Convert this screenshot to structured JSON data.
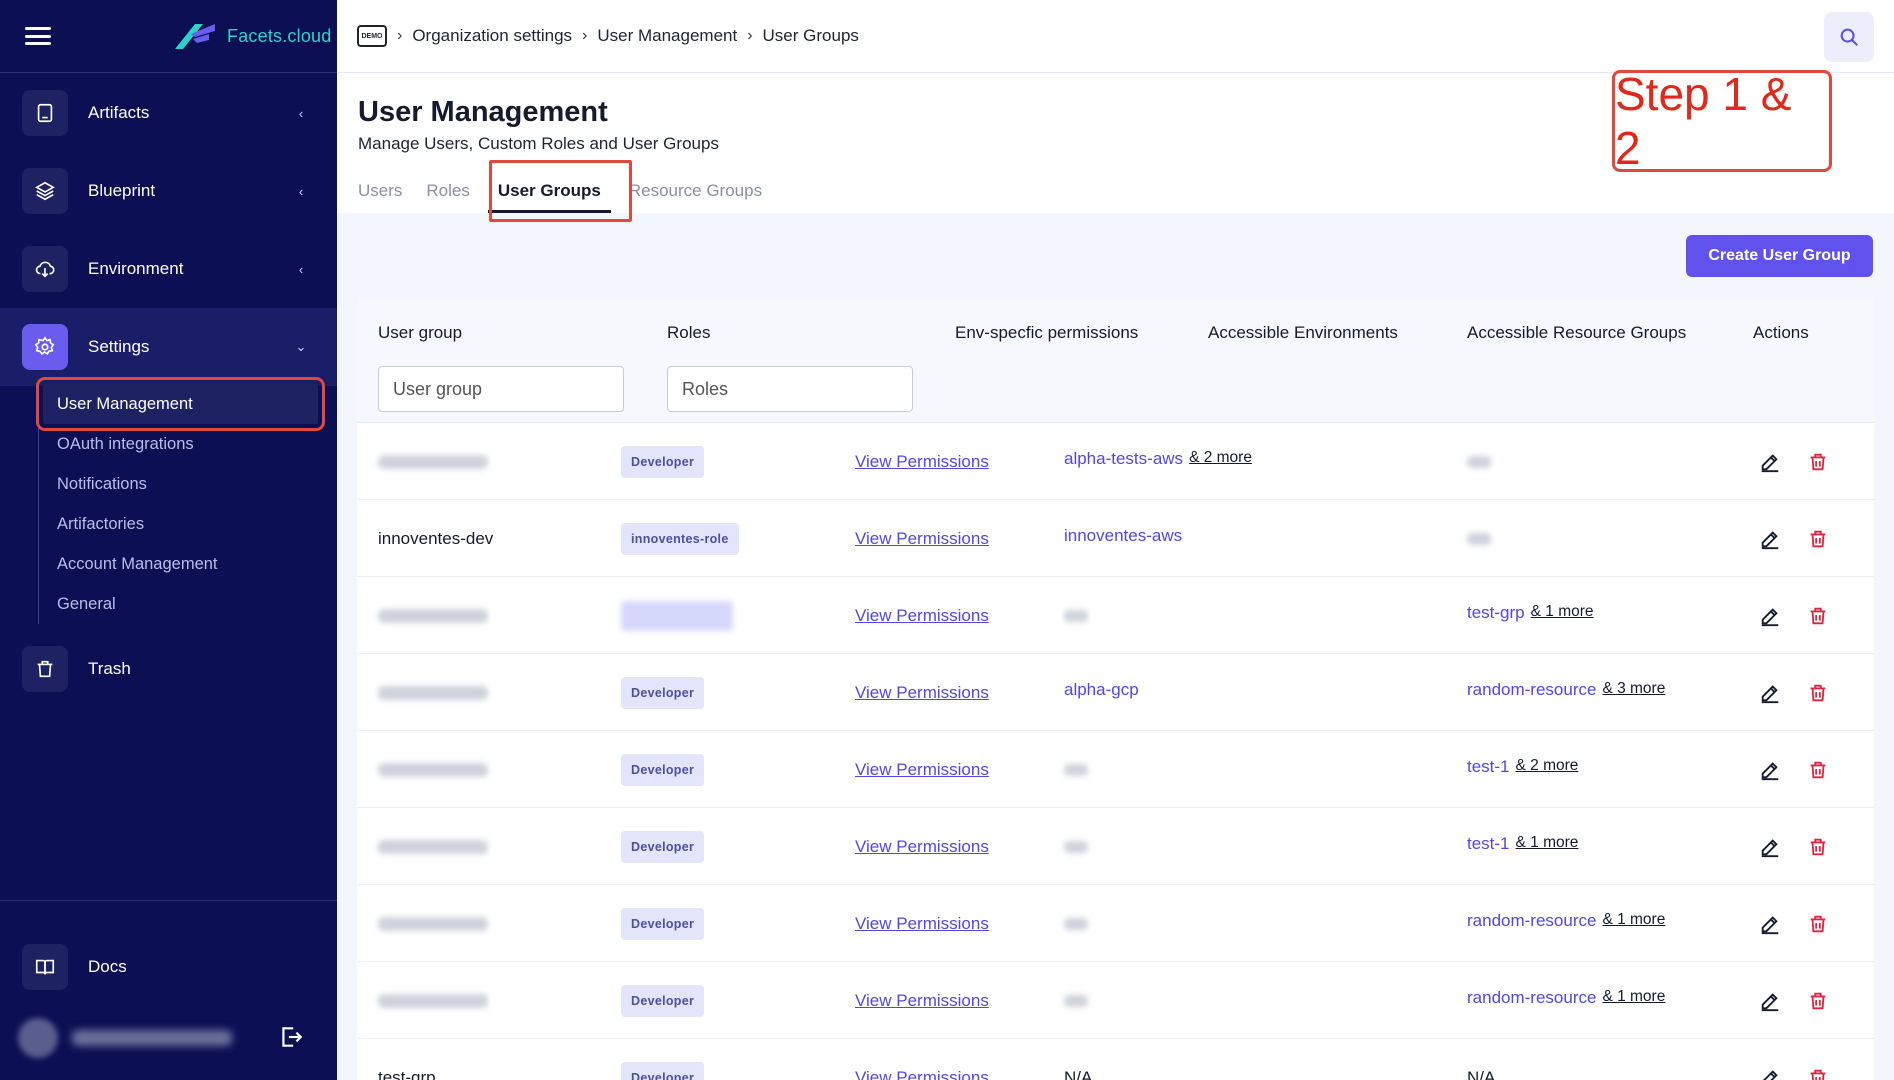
{
  "app": {
    "logo_text": "Facets.cloud"
  },
  "sidebar": {
    "items": [
      {
        "label": "Artifacts",
        "icon": "tablet-icon",
        "chevron": "‹"
      },
      {
        "label": "Blueprint",
        "icon": "layers-icon",
        "chevron": "‹"
      },
      {
        "label": "Environment",
        "icon": "cloud-download-icon",
        "chevron": "‹"
      },
      {
        "label": "Settings",
        "icon": "gear-icon",
        "chevron": "⌄"
      },
      {
        "label": "Trash",
        "icon": "trash-icon"
      },
      {
        "label": "Docs",
        "icon": "book-icon"
      }
    ],
    "sub_items": [
      {
        "label": "User Management"
      },
      {
        "label": "OAuth integrations"
      },
      {
        "label": "Notifications"
      },
      {
        "label": "Artifactories"
      },
      {
        "label": "Account Management"
      },
      {
        "label": "General"
      }
    ]
  },
  "breadcrumb": {
    "icon_text": "DEMO",
    "items": [
      "Organization settings",
      "User Management",
      "User Groups"
    ]
  },
  "header": {
    "title": "User Management",
    "subtitle": "Manage Users, Custom Roles and User Groups",
    "annotation": "Step 1 & 2",
    "tabs": [
      "Users",
      "Roles",
      "User Groups",
      "Resource Groups"
    ],
    "active_tab": "User Groups"
  },
  "actions": {
    "create_label": "Create User Group"
  },
  "table": {
    "columns": [
      "User group",
      "Roles",
      "Env-specfic permissions",
      "Accessible Environments",
      "Accessible Resource Groups",
      "Actions"
    ],
    "filters": {
      "user_group_placeholder": "User group",
      "roles_placeholder": "Roles"
    },
    "rows": [
      {
        "name": "",
        "role": "Developer",
        "perm": "View Permissions",
        "env": "alpha-tests-aws",
        "env_more": "& 2 more",
        "rg": "",
        "rg_more": ""
      },
      {
        "name": "innoventes-dev",
        "role": "innoventes-role",
        "perm": "View Permissions",
        "env": "innoventes-aws",
        "env_more": "",
        "rg": "",
        "rg_more": ""
      },
      {
        "name": "",
        "role": "",
        "perm": "View Permissions",
        "env": "",
        "env_more": "",
        "rg": "test-grp",
        "rg_more": "& 1 more"
      },
      {
        "name": "",
        "role": "Developer",
        "perm": "View Permissions",
        "env": "alpha-gcp",
        "env_more": "",
        "rg": "random-resource",
        "rg_more": "& 3 more"
      },
      {
        "name": "",
        "role": "Developer",
        "perm": "View Permissions",
        "env": "",
        "env_more": "",
        "rg": "test-1",
        "rg_more": "& 2 more"
      },
      {
        "name": "",
        "role": "Developer",
        "perm": "View Permissions",
        "env": "",
        "env_more": "",
        "rg": "test-1",
        "rg_more": "& 1 more"
      },
      {
        "name": "",
        "role": "Developer",
        "perm": "View Permissions",
        "env": "",
        "env_more": "",
        "rg": "random-resource",
        "rg_more": "& 1 more"
      },
      {
        "name": "",
        "role": "Developer",
        "perm": "View Permissions",
        "env": "",
        "env_more": "",
        "rg": "random-resource",
        "rg_more": "& 1 more"
      },
      {
        "name": "test-grp",
        "role": "Developer",
        "perm": "View Permissions",
        "env": "N/A",
        "env_more": "",
        "rg": "N/A",
        "rg_more": ""
      }
    ]
  },
  "colors": {
    "sidebar_bg": "#0c0f54",
    "accent": "#6152ee",
    "annotation_red": "#e2483c",
    "link": "#5147e6",
    "danger": "#e2233f"
  }
}
